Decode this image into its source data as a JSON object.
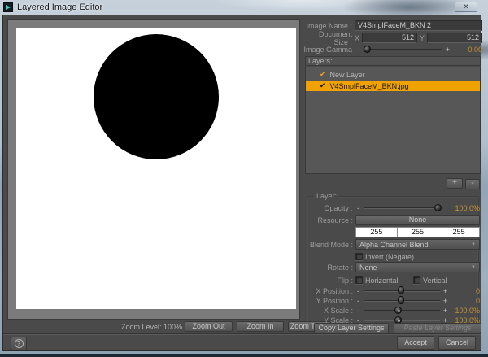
{
  "window": {
    "title": "Layered Image Editor"
  },
  "ui": {
    "minus": "-",
    "plus": "+",
    "check": "✔",
    "dropdown_arrow": "▼",
    "close": "✕",
    "help": "?"
  },
  "header": {
    "image_name_label": "Image Name :",
    "image_name_value": "V4SmplFaceM_BKN 2",
    "document_size_label": "Document Size :",
    "x_label": "X",
    "y_label": "Y",
    "doc_width": "512",
    "doc_height": "512",
    "image_gamma_label": "Image Gamma",
    "gamma_value": "0.00"
  },
  "layers_panel": {
    "header": "Layers:",
    "items": [
      {
        "label": "New Layer"
      },
      {
        "label": "V4SmplFaceM_BKN.jpg"
      }
    ],
    "add_label": "+",
    "remove_label": "-"
  },
  "layer_group": {
    "title": "Layer:",
    "opacity_label": "Opacity :",
    "opacity_value": "100.0%",
    "resource_label": "Resource :",
    "resource_value": "None",
    "color_values": [
      "255",
      "255",
      "255"
    ],
    "blend_mode_label": "Blend Mode :",
    "blend_mode_value": "Alpha Channel Blend",
    "invert_label": "Invert (Negate)",
    "rotate_label": "Rotate :",
    "rotate_value": "None",
    "flip_label": "Flip :",
    "flip_horizontal_label": "Horizontal",
    "flip_vertical_label": "Vertical",
    "x_position_label": "X Position :",
    "x_position_value": "0",
    "y_position_label": "Y Position :",
    "y_position_value": "0",
    "x_scale_label": "X Scale :",
    "x_scale_value": "100.0%",
    "y_scale_label": "Y Scale :",
    "y_scale_value": "100.0%",
    "copy_button": "Copy Layer Settings",
    "paste_button": "Paste Layer Settings"
  },
  "viewer": {
    "zoom_level_label": "Zoom Level: 100%",
    "zoom_out": "Zoom Out",
    "zoom_in": "Zoom In",
    "zoom_to_fit": "Zoom To Fit"
  },
  "footer": {
    "accept": "Accept",
    "cancel": "Cancel"
  },
  "colors": {
    "selection_orange": "#efa200",
    "value_amber": "#c59336",
    "canvas_bg": "#ffffff",
    "circle": "#000000",
    "dialog_bg": "#4a4a4a"
  }
}
